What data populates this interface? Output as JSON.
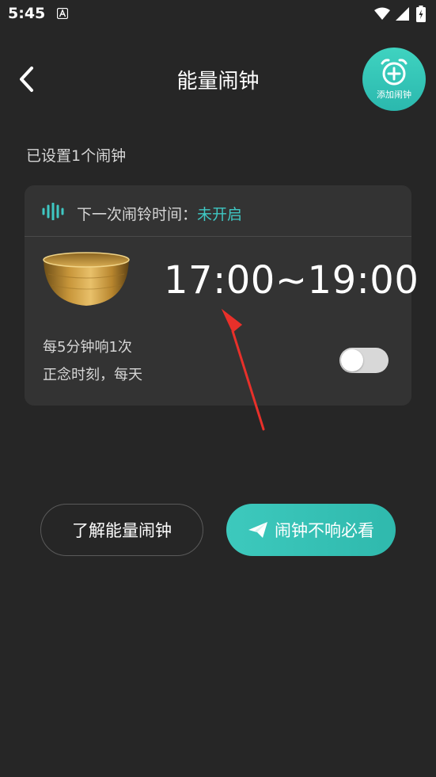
{
  "status_bar": {
    "time": "5:45",
    "icons": [
      "notification-a-icon",
      "wifi-icon",
      "signal-icon",
      "battery-icon"
    ]
  },
  "header": {
    "title": "能量闹钟",
    "back_icon": "chevron-left-icon",
    "add_button_label": "添加闹钟"
  },
  "alarm_summary": "已设置1个闹钟",
  "card": {
    "next_label": "下一次闹铃时间：",
    "next_value": "未开启",
    "time_range": "17:00~19:00",
    "interval": "每5分钟响1次",
    "schedule": "正念时刻，每天",
    "toggle_on": false
  },
  "buttons": {
    "learn": "了解能量闹钟",
    "help": "闹钟不响必看"
  },
  "colors": {
    "background": "#262626",
    "card": "#333333",
    "accent": "#3fc7c3",
    "arrow": "#e8302a"
  }
}
